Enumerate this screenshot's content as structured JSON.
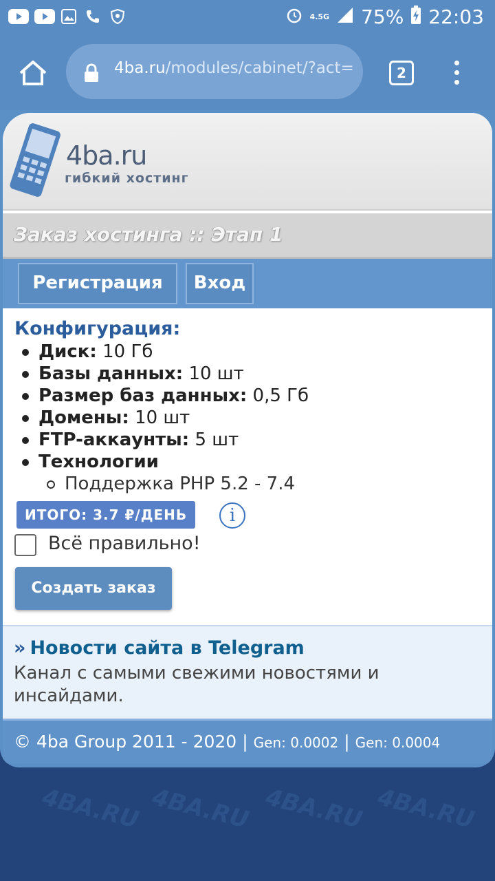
{
  "status_bar": {
    "battery": "75%",
    "time": "22:03",
    "network": "4.5G"
  },
  "browser": {
    "url_host": "4ba.ru",
    "url_path": "/modules/cabinet/?act=",
    "tab_count": "2"
  },
  "site": {
    "logo_name": "4ba.ru",
    "logo_tagline": "гибкий хостинг",
    "page_title": "Заказ хостинга :: Этап 1",
    "nav": [
      "Регистрация",
      "Вход"
    ],
    "watermark": "4BA.RU"
  },
  "config": {
    "title": "Конфигурация:",
    "specs": [
      {
        "label": "Диск:",
        "value": "10 Гб"
      },
      {
        "label": "Базы данных:",
        "value": "10 шт"
      },
      {
        "label": "Размер баз данных:",
        "value": "0,5 Гб"
      },
      {
        "label": "Домены:",
        "value": "10 шт"
      },
      {
        "label": "FTP-аккаунты:",
        "value": "5 шт"
      },
      {
        "label": "Технологии",
        "value": ""
      }
    ],
    "technologies": [
      "Поддержка PHP 5.2 - 7.4"
    ],
    "total": "ИТОГО: 3.7 ₽/ДЕНЬ",
    "info_symbol": "i",
    "confirm_label": "Всё правильно!",
    "submit_label": "Создать заказ"
  },
  "news": {
    "arrow": "»",
    "link_text": "Новости сайта в Telegram",
    "description": "Канал с самыми свежими новостями и инсайдами."
  },
  "footer": {
    "copyright": "© 4ba Group 2011 - 2020",
    "separator": "|",
    "gen1": "Gen: 0.0002",
    "gen2": "Gen: 0.0004"
  },
  "colors": {
    "chrome_blue": "#5a8cc4",
    "page_blue": "#23447a",
    "accent": "#2b5d9c",
    "total_badge": "#5880c8"
  }
}
